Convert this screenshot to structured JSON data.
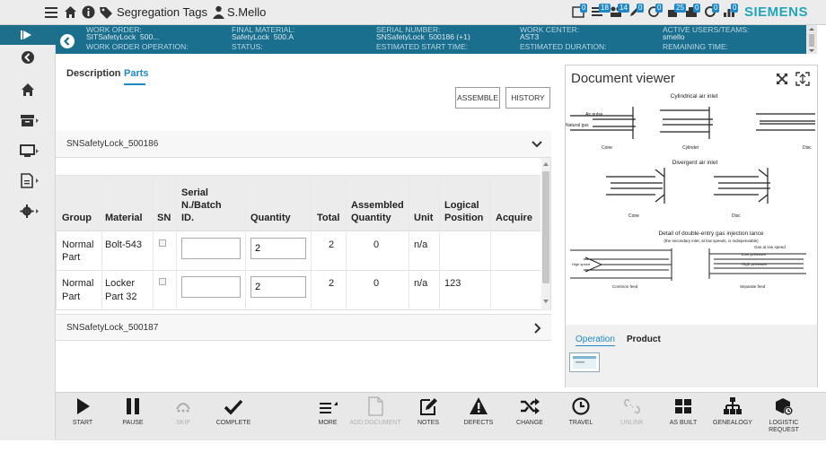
{
  "topbar": {
    "breadcrumb": "Segregation Tags",
    "user": "S.Mello",
    "badges": [
      "0",
      "18",
      "14",
      "0",
      "0",
      "25",
      "0",
      "0",
      "0"
    ],
    "brand": "SIEMENS"
  },
  "header": {
    "row1": [
      {
        "label": "WORK ORDER:",
        "value": "SITSafetyLock_500..."
      },
      {
        "label": "FINAL MATERIAL:",
        "value": "SafetyLock_500.A"
      },
      {
        "label": "SERIAL NUMBER:",
        "value": "SNSafetyLock_500186 (+1)"
      },
      {
        "label": "WORK CENTER:",
        "value": "AST3"
      },
      {
        "label": "ACTIVE USERS/TEAMS:",
        "value": "smello"
      }
    ],
    "row2": [
      {
        "label": "WORK ORDER OPERATION:"
      },
      {
        "label": "STATUS:"
      },
      {
        "label": "ESTIMATED START TIME:"
      },
      {
        "label": "ESTIMATED DURATION:"
      },
      {
        "label": "REMAINING TIME:"
      }
    ]
  },
  "tabs": {
    "description": "Description",
    "parts": "Parts"
  },
  "actions": {
    "assemble": "ASSEMBLE",
    "history": "HISTORY"
  },
  "panels": {
    "first": "SNSafetyLock_500186",
    "second": "SNSafetyLock_500187"
  },
  "table": {
    "headers": {
      "group": "Group",
      "material": "Material",
      "sn": "SN",
      "serial_l1": "Serial",
      "serial_l2": "N./Batch",
      "serial_l3": "ID.",
      "quantity": "Quantity",
      "total": "Total",
      "assembled_l1": "Assembled",
      "assembled_l2": "Quantity",
      "unit": "Unit",
      "logical_l1": "Logical",
      "logical_l2": "Position",
      "acquire": "Acquire"
    },
    "rows": [
      {
        "group_l1": "Normal",
        "group_l2": "Part",
        "material_l1": "Bolt-543",
        "material_l2": "",
        "serial": "",
        "quantity": "2",
        "total": "2",
        "assembled": "0",
        "unit": "n/a",
        "logical": ""
      },
      {
        "group_l1": "Normal",
        "group_l2": "Part",
        "material_l1": "Locker",
        "material_l2": "Part 32",
        "serial": "",
        "quantity": "2",
        "total": "2",
        "assembled": "0",
        "unit": "n/a",
        "logical": "123"
      }
    ]
  },
  "viewer": {
    "title": "Document viewer",
    "tabs": {
      "operation": "Operation",
      "product": "Product"
    },
    "drawing": {
      "t1": "Cylindrical air inlet",
      "airpulse": "Air pulse",
      "natgas": "Natural gas",
      "cone": "Cone",
      "cylinder": "Cylinder",
      "disc": "Disc",
      "t2": "Divergent air inlet",
      "cone2": "Cone",
      "disc2": "Disc",
      "t3": "Detail of double-entry gas injection lance",
      "t3b": "(the secondary inlet, at low speeds, is indispensable)",
      "gas_low": "Gas at low speed",
      "low_p": "Low pressure",
      "high_p": "High pressure",
      "high_speed": "High speed",
      "common": "Common feed",
      "separate": "Separate feed"
    }
  },
  "toolbar": [
    {
      "id": "start",
      "label": "START",
      "icon": "play-icon",
      "enabled": true
    },
    {
      "id": "pause",
      "label": "PAUSE",
      "icon": "pause-icon",
      "enabled": true
    },
    {
      "id": "skip",
      "label": "SKIP",
      "icon": "skip-icon",
      "enabled": false
    },
    {
      "id": "complete",
      "label": "COMPLETE",
      "icon": "check-icon",
      "enabled": true
    },
    {
      "id": "more",
      "label": "MORE",
      "icon": "more-icon",
      "enabled": true
    },
    {
      "id": "add_document",
      "label": "ADD DOCUMENT",
      "icon": "document-icon",
      "enabled": false
    },
    {
      "id": "notes",
      "label": "NOTES",
      "icon": "notes-icon",
      "enabled": true
    },
    {
      "id": "defects",
      "label": "DEFECTS",
      "icon": "warning-icon",
      "enabled": true
    },
    {
      "id": "change",
      "label": "CHANGE",
      "icon": "shuffle-icon",
      "enabled": true
    },
    {
      "id": "travel",
      "label": "TRAVEL",
      "icon": "clock-icon",
      "enabled": true
    },
    {
      "id": "unlink",
      "label": "UNLINK",
      "icon": "unlink-icon",
      "enabled": false
    },
    {
      "id": "as_built",
      "label": "AS BUILT",
      "icon": "grid-icon",
      "enabled": true
    },
    {
      "id": "genealogy",
      "label": "GENEALOGY",
      "icon": "hierarchy-icon",
      "enabled": true
    },
    {
      "id": "logistic_request",
      "label": "LOGISTIC REQUEST",
      "icon": "logistic-icon",
      "enabled": true
    }
  ],
  "colors": {
    "accent": "#1e88c8",
    "header": "#1b6f8e",
    "brand": "#22a5b9"
  }
}
